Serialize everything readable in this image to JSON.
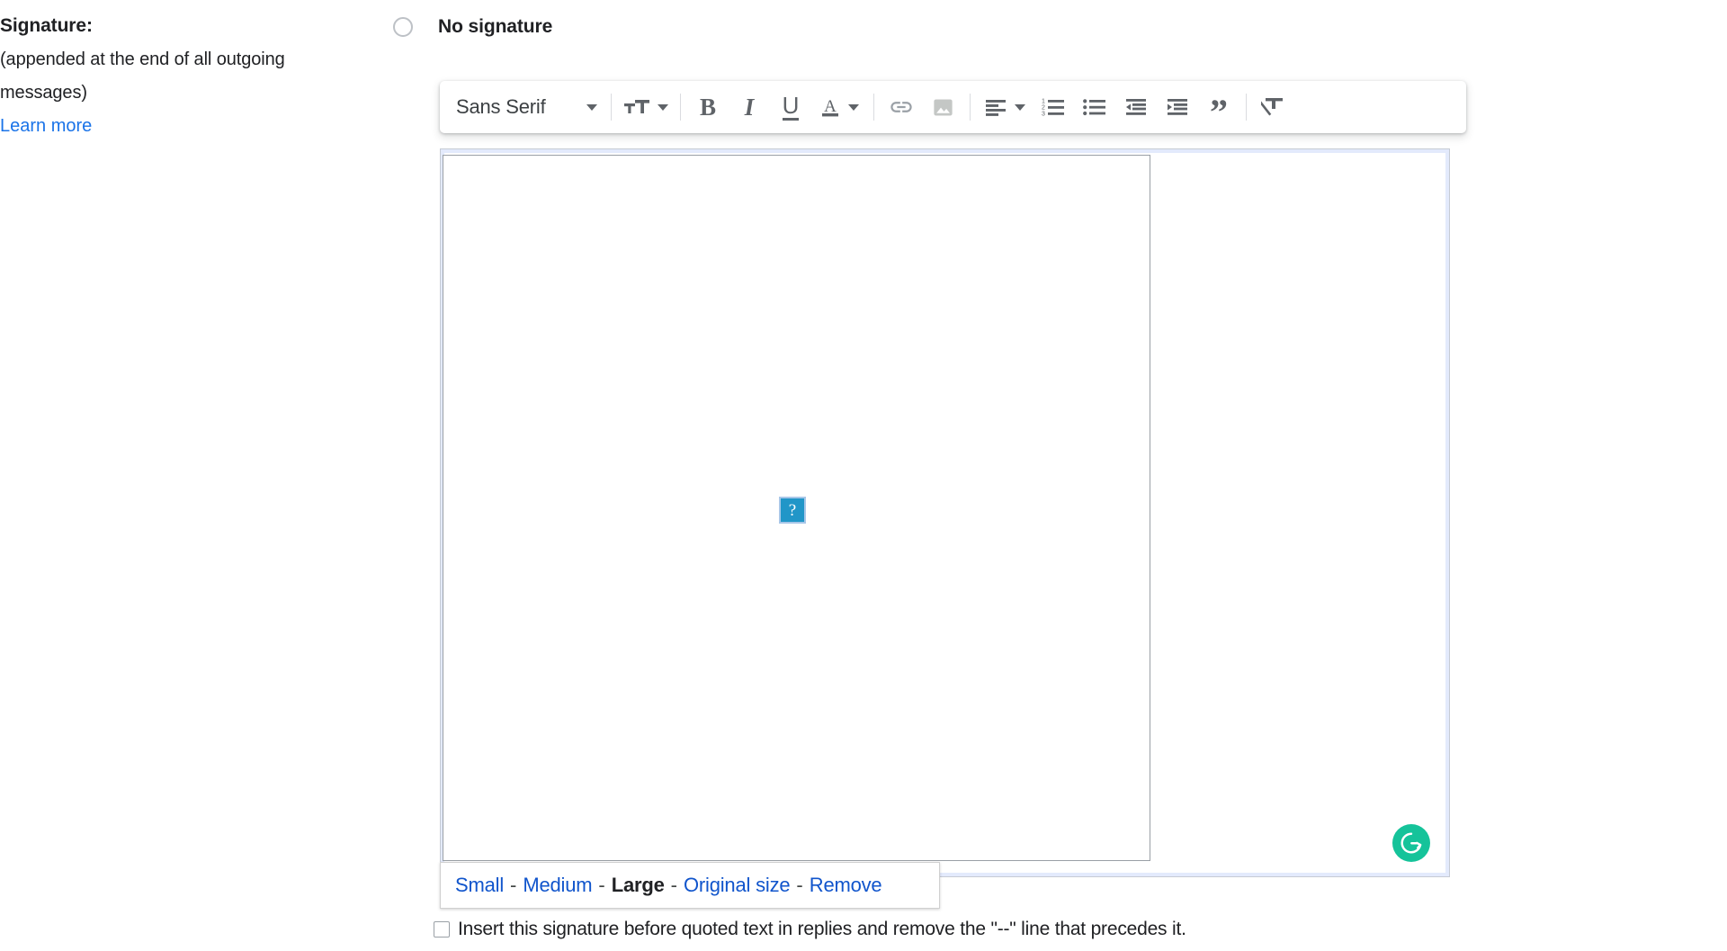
{
  "left_panel": {
    "title": "Signature:",
    "description": "(appended at the end of all outgoing messages)",
    "learn_more": "Learn more"
  },
  "signature_options": {
    "no_signature_label": "No signature",
    "no_signature_selected": false,
    "custom_signature_selected": true
  },
  "editor_toolbar": {
    "font_name": "Sans Serif",
    "buttons": [
      {
        "name": "font-family-dropdown",
        "label": "Sans Serif",
        "icon": "chevron-down-icon"
      },
      {
        "name": "font-size-button",
        "icon": "font-size-icon"
      },
      {
        "name": "bold-button",
        "icon": "bold-icon",
        "glyph": "B"
      },
      {
        "name": "italic-button",
        "icon": "italic-icon",
        "glyph": "I"
      },
      {
        "name": "underline-button",
        "icon": "underline-icon",
        "glyph": "U"
      },
      {
        "name": "text-color-button",
        "icon": "text-color-icon",
        "glyph": "A"
      },
      {
        "name": "insert-link-button",
        "icon": "link-icon"
      },
      {
        "name": "insert-image-button",
        "icon": "image-icon"
      },
      {
        "name": "align-button",
        "icon": "align-left-icon"
      },
      {
        "name": "numbered-list-button",
        "icon": "numbered-list-icon"
      },
      {
        "name": "bulleted-list-button",
        "icon": "bulleted-list-icon"
      },
      {
        "name": "indent-less-button",
        "icon": "indent-less-icon"
      },
      {
        "name": "indent-more-button",
        "icon": "indent-more-icon"
      },
      {
        "name": "quote-button",
        "icon": "quote-icon"
      },
      {
        "name": "remove-formatting-button",
        "icon": "remove-formatting-icon"
      }
    ],
    "numbered_list_digits": [
      "1",
      "2",
      "3"
    ]
  },
  "signature_content": {
    "broken_image_glyph": "?",
    "broken_image_color": "#2196c8"
  },
  "grammarly": {
    "label": "G",
    "color": "#15c39a"
  },
  "image_size_popup": {
    "options": [
      {
        "label": "Small",
        "selected": false
      },
      {
        "label": "Medium",
        "selected": false
      },
      {
        "label": "Large",
        "selected": true
      },
      {
        "label": "Original size",
        "selected": false
      },
      {
        "label": "Remove",
        "selected": false
      }
    ],
    "separator": "-"
  },
  "bottom_option": {
    "label": "Insert this signature before quoted text in replies and remove the \"--\" line that precedes it.",
    "checked": false
  },
  "colors": {
    "link": "#1a73e8",
    "popup_link": "#1155cc",
    "accent": "#1a73e8",
    "icon": "#5f6368",
    "focus_border": "#e3eafc"
  }
}
